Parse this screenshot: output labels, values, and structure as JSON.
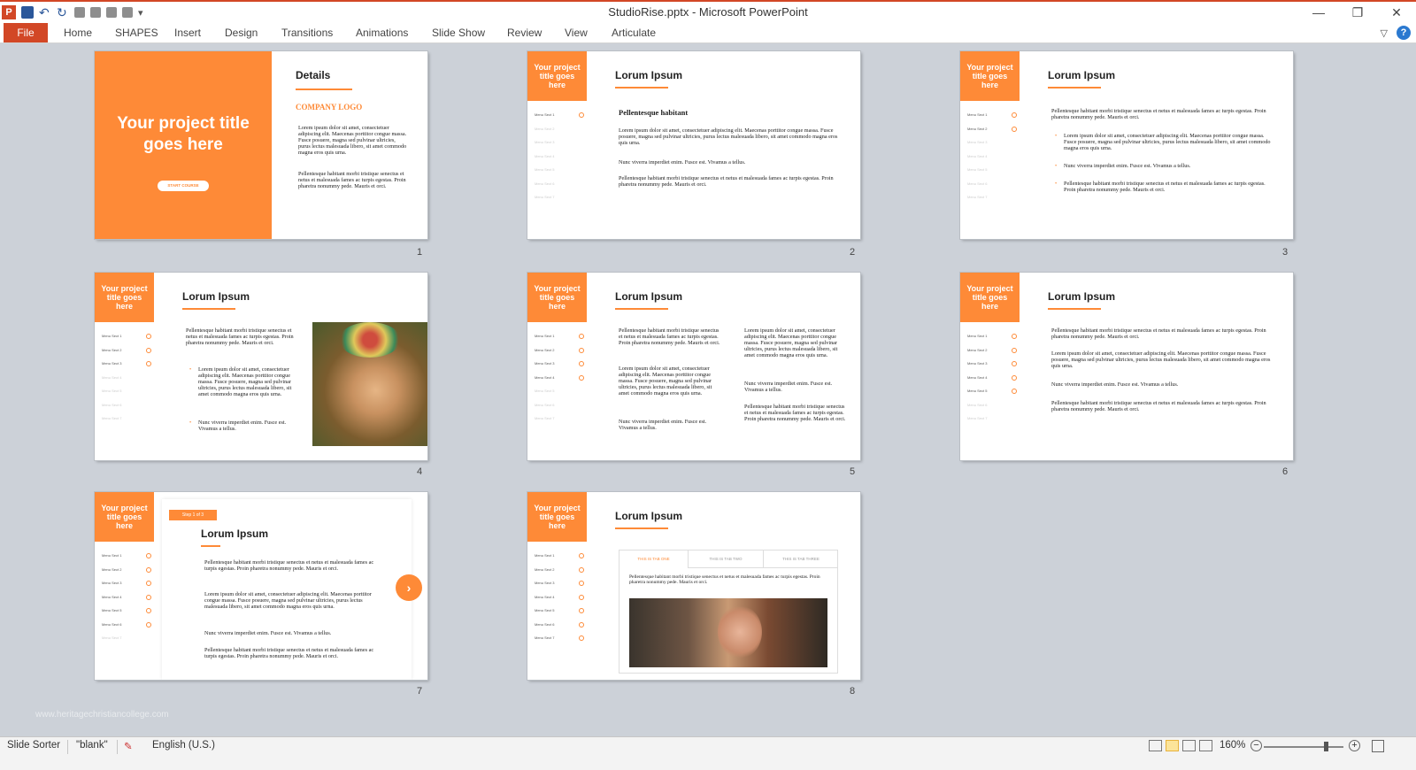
{
  "window": {
    "title": "StudioRise.pptx  -  Microsoft PowerPoint",
    "controls": [
      "—",
      "❐",
      "✕"
    ]
  },
  "ribbon": {
    "file": "File",
    "tabs": [
      "Home",
      "SHAPES",
      "Insert",
      "Design",
      "Transitions",
      "Animations",
      "Slide Show",
      "Review",
      "View",
      "Articulate"
    ]
  },
  "common": {
    "project_title": "Your project title goes here",
    "lorum": "Lorum Ipsum",
    "menu": [
      "Menu Sect 1",
      "Menu Sect 2",
      "Menu Sect 3",
      "Menu Sect 4",
      "Menu Sect 5",
      "Menu Sect 6",
      "Menu Sect 7"
    ],
    "p_pellentesque": "Pellentesque habitant morbi tristique senectus et netus et malesuada fames ac turpis egestas. Proin pharetra nonummy pede. Mauris et orci.",
    "p_lorem": "Lorem ipsum dolor sit amet, consectetuer adipiscing elit. Maecenas porttitor congue massa. Fusce posuere, magna sed pulvinar ultricies, purus lectus malesuada libero, sit amet commodo magna eros quis urna.",
    "p_nunc": "Nunc viverra imperdiet enim. Fusce est. Vivamus a tellus."
  },
  "slide1": {
    "title": "Your project title goes here",
    "button": "START COURSE",
    "details": "Details",
    "logo": "COMPANY LOGO"
  },
  "slide2": {
    "subheading": "Pellentesque habitant"
  },
  "slide7": {
    "step": "Step 1 of 3",
    "next": "›"
  },
  "slide8": {
    "tabs": [
      "THIS IS TAB ONE",
      "THIS IS TAB TWO",
      "THIS IS TAB THREE"
    ],
    "text": "Pellentesque habitant morbi tristique senectus et netus et malesuada fames ac turpis egestas. Proin pharetra nonummy pede. Mauris et orci."
  },
  "slide_numbers": [
    "1",
    "2",
    "3",
    "4",
    "5",
    "6",
    "7",
    "8"
  ],
  "watermark": "www.heritagechristiancollege.com",
  "status": {
    "view": "Slide Sorter",
    "theme": "\"blank\"",
    "language": "English (U.S.)",
    "zoom": "160%",
    "zoom_level": 0.78
  },
  "colors": {
    "accent": "#fe8a37",
    "file_tab": "#d24726",
    "background": "#ccd1d8"
  }
}
